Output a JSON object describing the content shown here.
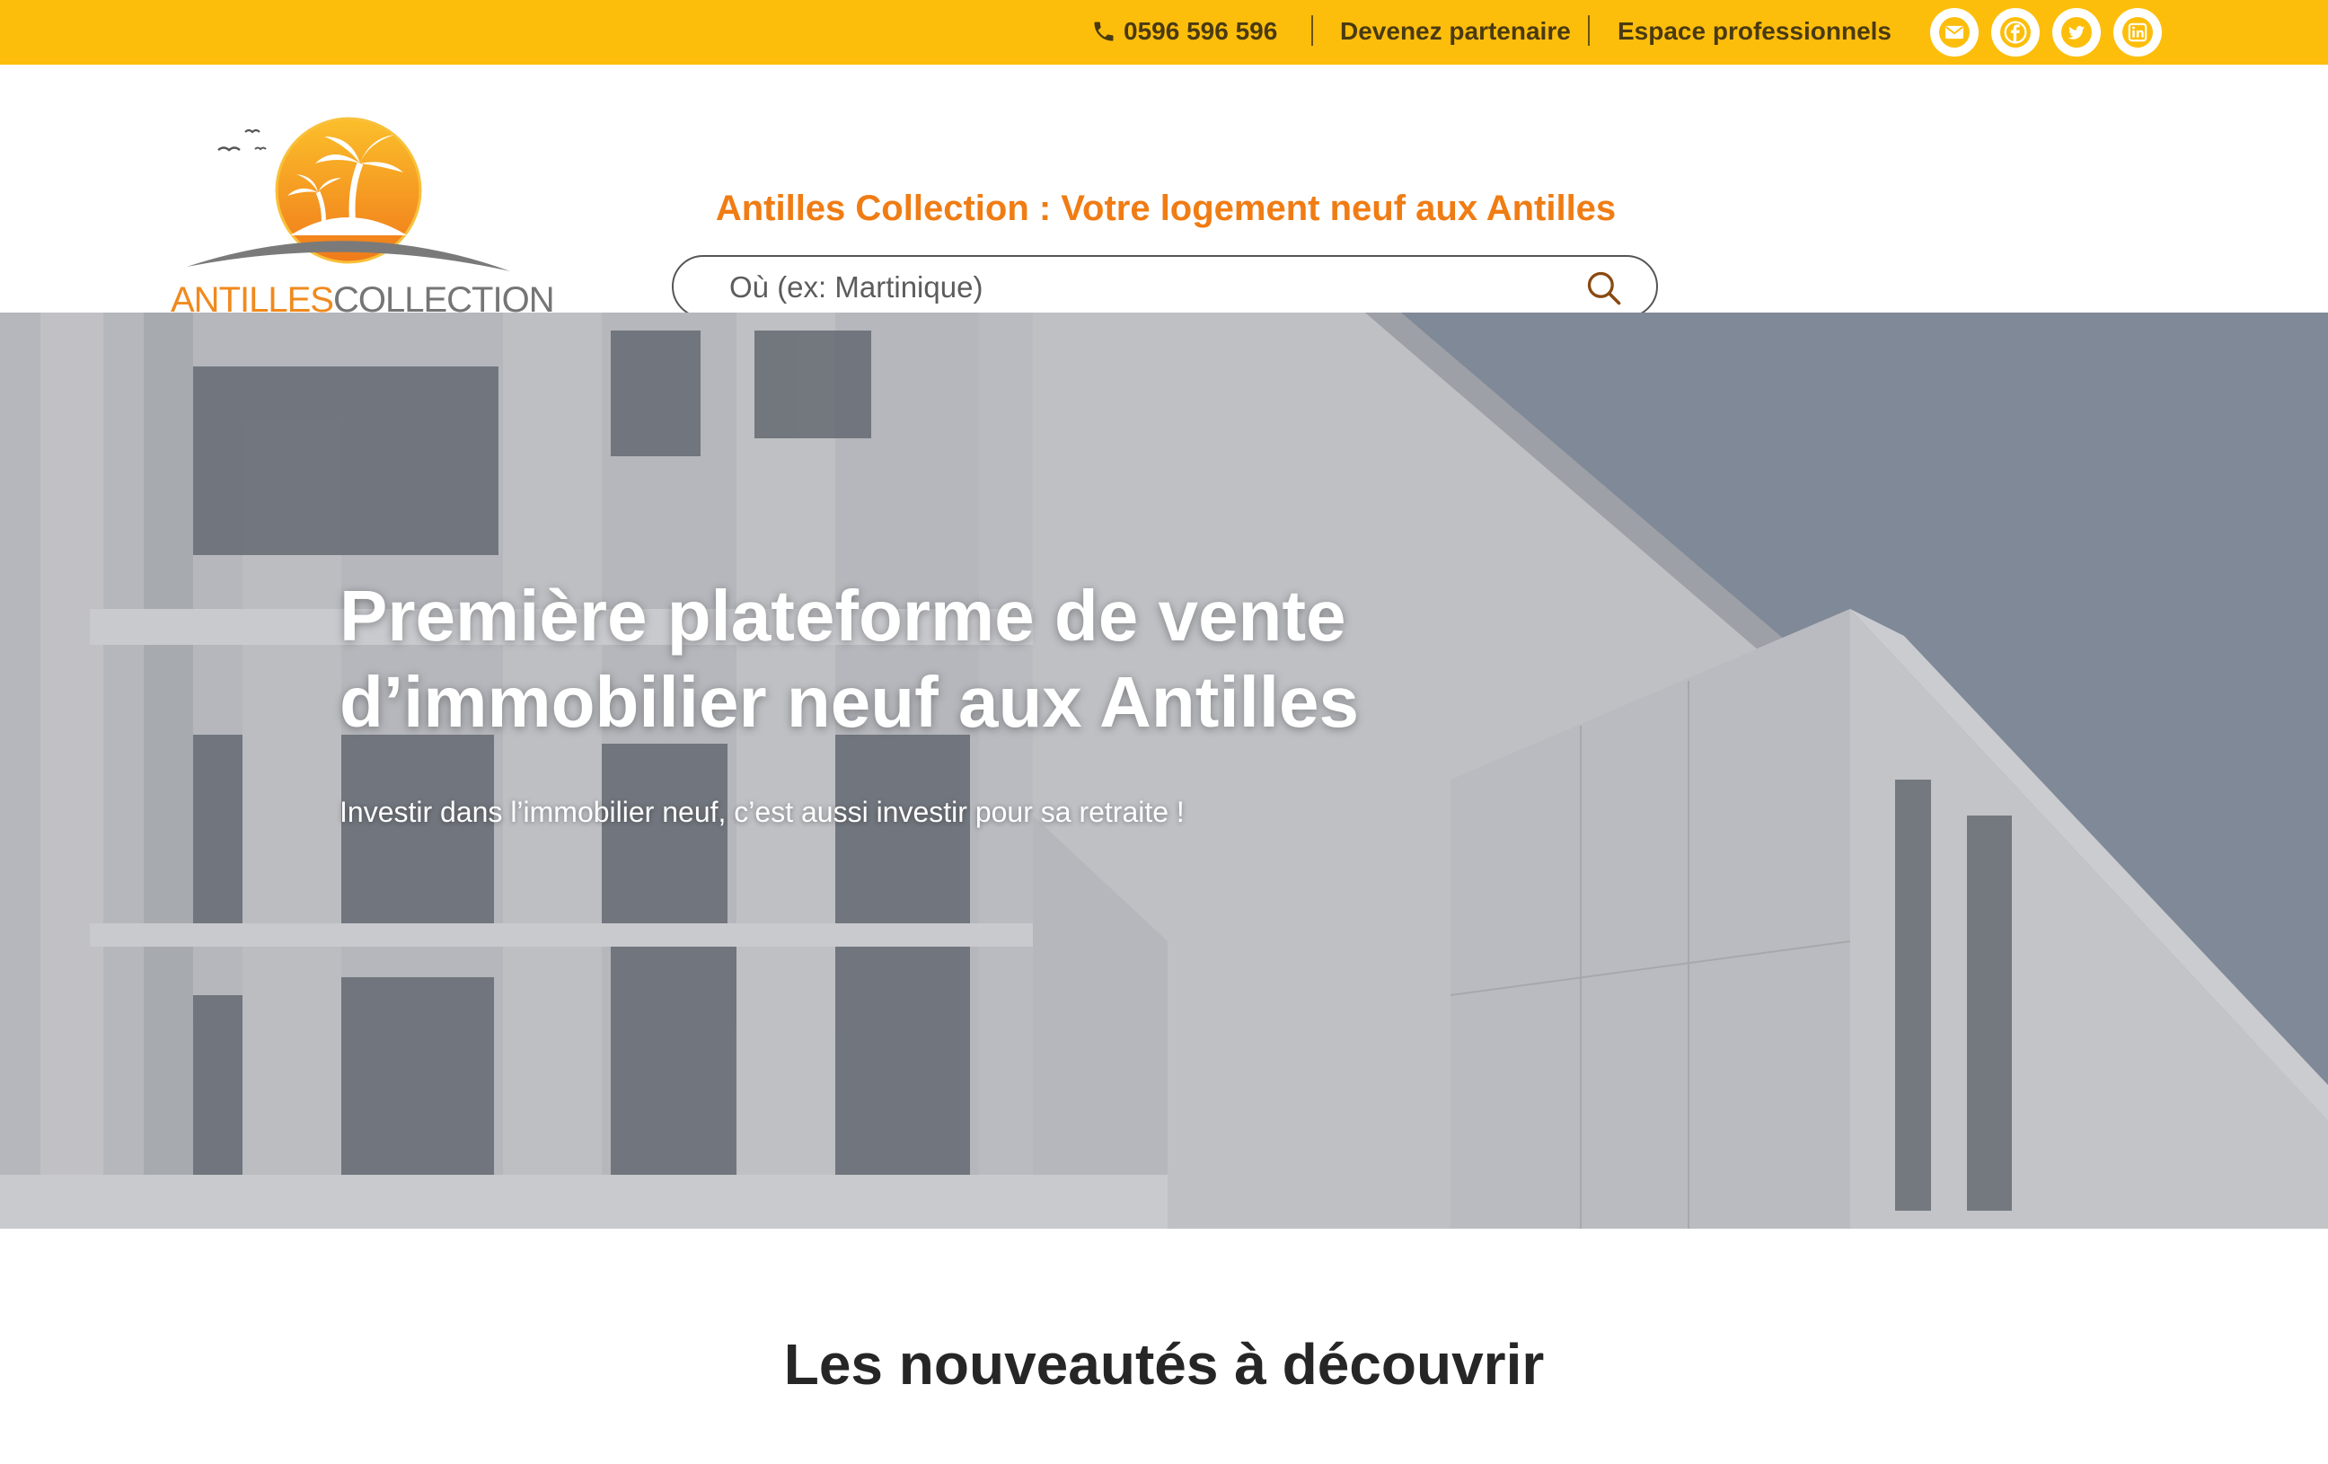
{
  "topbar": {
    "phone": "0596 596 596",
    "partner_link": "Devenez partenaire",
    "pro_link": "Espace professionnels",
    "socials": [
      "mail-icon",
      "facebook-icon",
      "twitter-icon",
      "linkedin-icon"
    ],
    "background_color": "#fdbe0b"
  },
  "header": {
    "logo": {
      "part1": "ANTILLES",
      "part2": "COLLECTION"
    },
    "tagline": "Antilles Collection : Votre logement neuf aux Antilles",
    "search": {
      "placeholder": "Où (ex: Martinique)",
      "value": ""
    },
    "accent_color": "#f07c14"
  },
  "hero": {
    "title_line1": "Première plateforme de vente",
    "title_line2": "d’immobilier neuf aux Antilles",
    "subtitle": "Investir dans l’immobilier neuf, c’est aussi investir pour sa retraite !"
  },
  "section": {
    "title": "Les nouveautés à découvrir"
  }
}
